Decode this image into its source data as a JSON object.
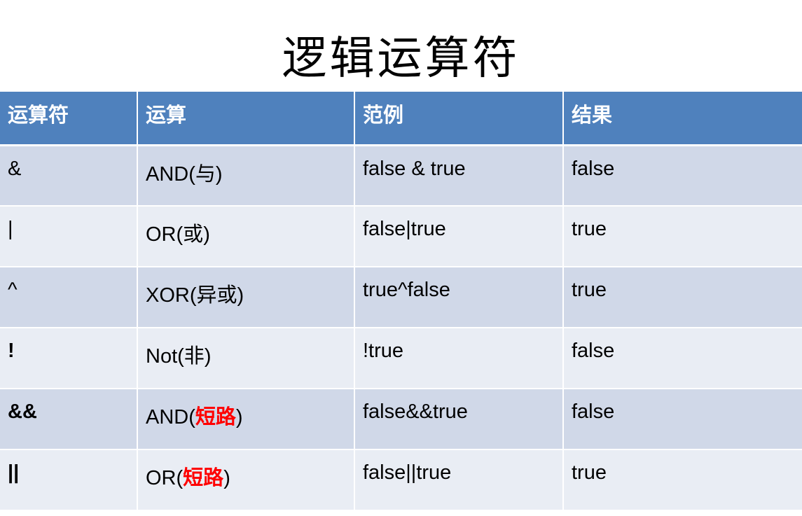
{
  "title": "逻辑运算符",
  "table": {
    "headers": [
      "运算符",
      "运算",
      "范例",
      "结果"
    ],
    "rows": [
      {
        "op": "&",
        "name_prefix": "AND(",
        "name_note": "与",
        "name_suffix": ")",
        "example": "false & true",
        "result": "false"
      },
      {
        "op": "|",
        "name_prefix": "OR(",
        "name_note": "或",
        "name_suffix": ")",
        "example": "false|true",
        "result": "true"
      },
      {
        "op": "^",
        "name_prefix": "XOR(",
        "name_note": "异或",
        "name_suffix": ")",
        "example": "true^false",
        "result": "true"
      },
      {
        "op": "!",
        "name_prefix": "Not(",
        "name_note": "非",
        "name_suffix": ")",
        "example": "!true",
        "result": "false"
      },
      {
        "op": "&&",
        "name_prefix": "AND(",
        "name_note": "短路",
        "name_suffix": ")",
        "example": "false&&true",
        "result": "false"
      },
      {
        "op": "||",
        "name_prefix": "OR(",
        "name_note": "短路",
        "name_suffix": ")",
        "example": "false||true",
        "result": "true"
      }
    ]
  },
  "colors": {
    "header_bg": "#4f81bd",
    "row_odd_bg": "#d0d8e8",
    "row_even_bg": "#e9edf4",
    "highlight_operator": "#0000ff",
    "highlight_note": "#ff0000"
  }
}
